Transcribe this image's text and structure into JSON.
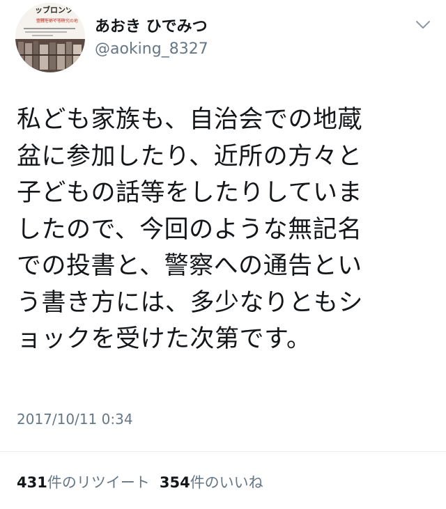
{
  "user": {
    "display_name": "あおき ひでみつ",
    "handle": "@aoking_8327",
    "avatar_lettering": {
      "title": "ッブロンツ",
      "subtitle": "金銭をめぐる研究の地"
    }
  },
  "tweet": {
    "lines": [
      "私ども家族も、自治会での地蔵",
      "盆に参加したり、近所の方々と",
      "子どもの話等をしたりしていま",
      "したので、今回のような無記名",
      "での投書と、警察への通告とい",
      "う書き方には、多少なりともシ",
      "ョックを受けた次第です。"
    ],
    "timestamp": "2017/10/11 0:34"
  },
  "stats": {
    "retweet_count": "431",
    "retweet_label": "件のリツイート",
    "like_count": "354",
    "like_label": "件のいいね"
  },
  "icons": {
    "menu": "chevron-down-icon"
  },
  "colors": {
    "text": "#14171a",
    "secondary": "#657786",
    "divider": "#e6ecf0"
  }
}
